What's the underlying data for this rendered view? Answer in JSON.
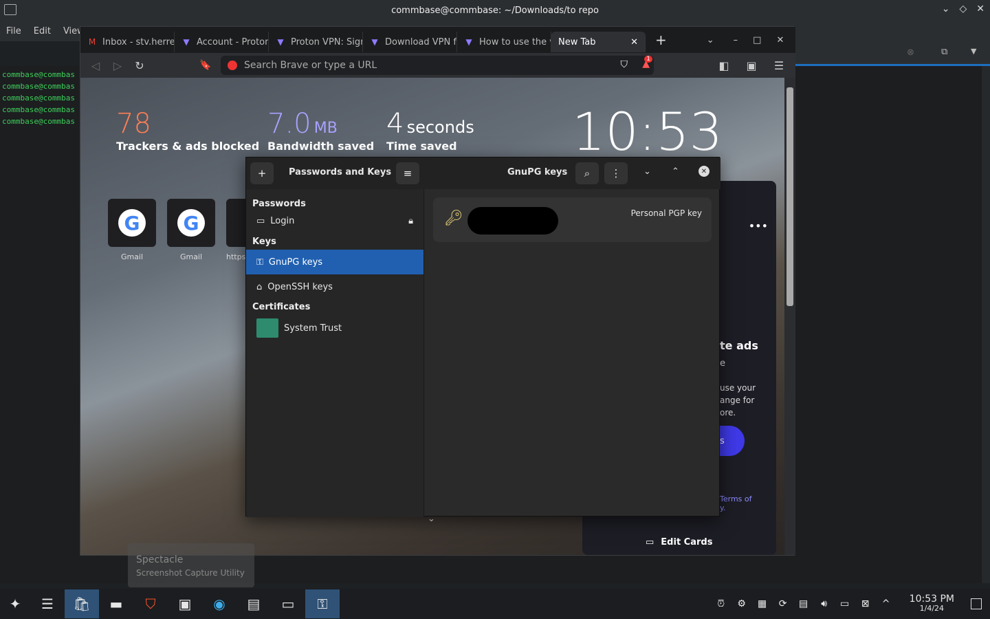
{
  "terminal": {
    "title": "commbase@commbase: ~/Downloads/to repo",
    "menu": [
      "File",
      "Edit",
      "View"
    ],
    "lines": [
      "commbase@commbas",
      "commbase@commbas",
      "commbase@commbas",
      "commbase@commbas",
      "commbase@commbas"
    ]
  },
  "browser": {
    "tabs": [
      {
        "label": "Inbox - stv.herre",
        "icon": "gmail-icon"
      },
      {
        "label": "Account - Proton",
        "icon": "proton-icon"
      },
      {
        "label": "Proton VPN: Sign",
        "icon": "proton-icon"
      },
      {
        "label": "Download VPN f",
        "icon": "proton-icon"
      },
      {
        "label": "How to use the v",
        "icon": "proton-icon"
      },
      {
        "label": "New Tab",
        "icon": ""
      }
    ],
    "url_placeholder": "Search Brave or type a URL",
    "shields_badge": "1"
  },
  "ntp": {
    "trackers": "78",
    "trackers_label": "Trackers & ads blocked",
    "bandwidth": "7.0",
    "bandwidth_unit": "MB",
    "bandwidth_label": "Bandwidth saved",
    "time": "4",
    "time_unit": "seconds",
    "time_label": "Time saved",
    "clock": "10:53",
    "tiles": [
      {
        "label": "Gmail"
      },
      {
        "label": "Gmail"
      },
      {
        "label": "https"
      }
    ],
    "card_heading": "te ads",
    "card_sub": "e",
    "card_text1": "use your",
    "card_text2": "ange for",
    "card_text3": "ore.",
    "card_btn": "s",
    "card_terms": "Terms of",
    "card_terms2": "y.",
    "edit_cards": "Edit Cards",
    "colors": {
      "trackers": "#ff7e55",
      "bandwidth": "#a8a2ff"
    }
  },
  "dialog": {
    "title": "Passwords and Keys",
    "panel_title": "GnuPG keys",
    "sections": {
      "passwords": "Passwords",
      "keys": "Keys",
      "certs": "Certificates"
    },
    "items": {
      "login": "Login",
      "gnupg": "GnuPG keys",
      "openssh": "OpenSSH keys",
      "trust": "System Trust"
    },
    "key_type": "Personal PGP key"
  },
  "toast": {
    "title": "Spectacle",
    "subtitle": "Screenshot Capture Utility"
  },
  "clock": {
    "time": "10:53 PM",
    "date": "1/4/24"
  }
}
